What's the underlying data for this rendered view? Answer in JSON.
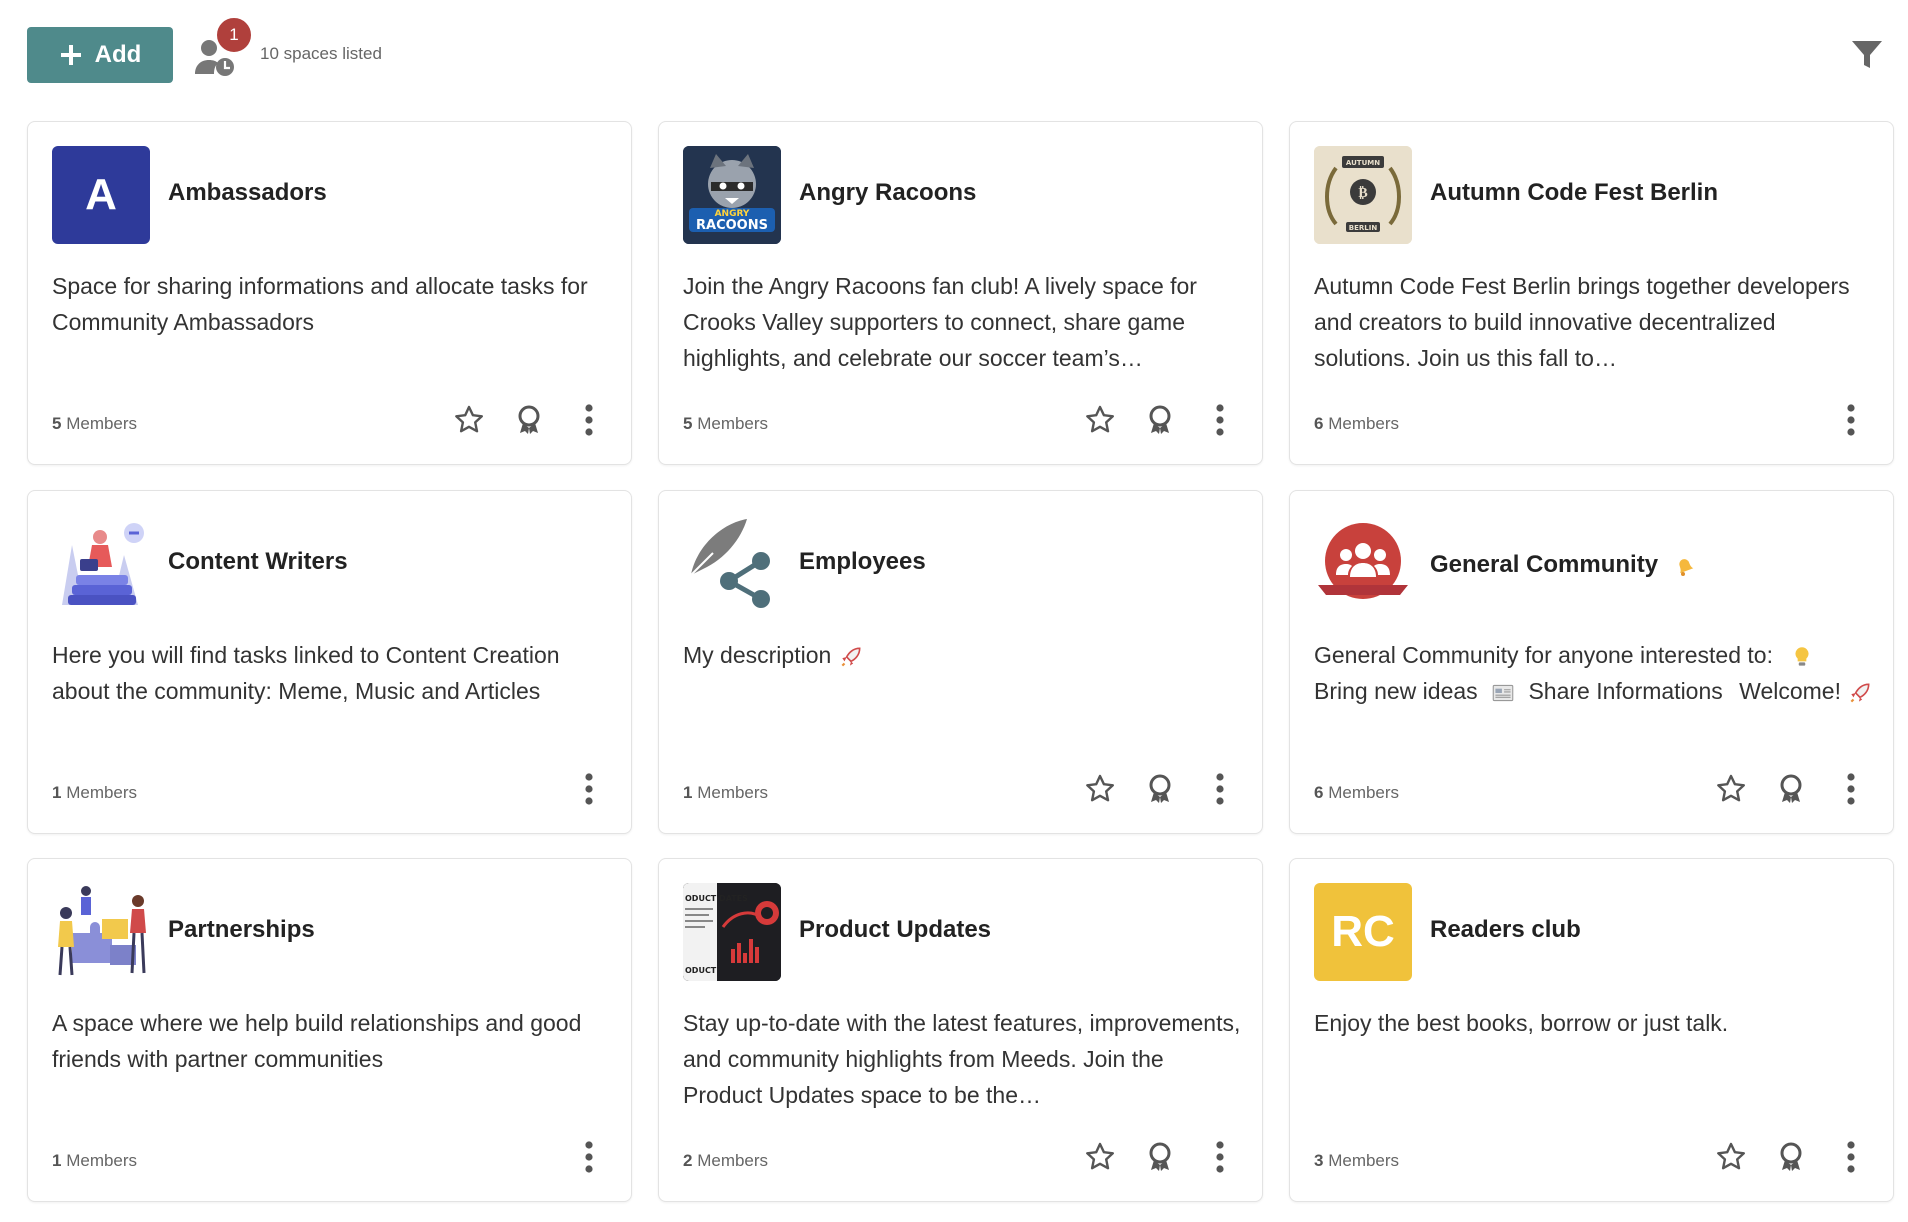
{
  "toolbar": {
    "add_label": "Add",
    "pending_requests_badge": "1",
    "spaces_count": "10 spaces listed"
  },
  "colors": {
    "primary": "#4f8a8b",
    "badge": "#b0403c",
    "ambassadors_avatar": "#2e3a9a",
    "readers_avatar": "#f0c23b",
    "general_avatar": "#c8413c"
  },
  "spaces": [
    {
      "title": "Ambassadors",
      "avatar_text": "A",
      "description": "Space for sharing informations and allocate tasks for Community Ambassadors",
      "members_count": "5",
      "members_label": "Members"
    },
    {
      "title": "Angry Racoons",
      "avatar_text": "ANGRY RACOONS",
      "description": "Join the Angry Racoons fan club! A lively space for Crooks Valley supporters to connect, share game highlights, and celebrate our soccer team’s…",
      "members_count": "5",
      "members_label": "Members"
    },
    {
      "title": "Autumn Code Fest Berlin",
      "avatar_text": "AUTUMN CODE FEST BERLIN",
      "description": "Autumn Code Fest Berlin brings together developers and creators to build innovative decentralized solutions. Join us this fall to…",
      "members_count": "6",
      "members_label": "Members"
    },
    {
      "title": "Content Writers",
      "description": "Here you will find tasks linked to Content Creation about the community: Meme, Music and Articles",
      "members_count": "1",
      "members_label": "Members"
    },
    {
      "title": "Employees",
      "description": "My description",
      "members_count": "1",
      "members_label": "Members"
    },
    {
      "title": "General Community",
      "description_a": "General Community for anyone interested to:",
      "description_b": "Bring new ideas",
      "description_c": "Share Informations",
      "description_d": "Welcome!",
      "members_count": "6",
      "members_label": "Members"
    },
    {
      "title": "Partnerships",
      "description": "A space where we help build relationships and good friends with partner communities",
      "members_count": "1",
      "members_label": "Members"
    },
    {
      "title": "Product Updates",
      "avatar_text_top": "ODUCT DATES",
      "avatar_text_bottom": "ODUCT DATES",
      "description": "Stay up-to-date with the latest features, improvements, and community highlights from Meeds. Join the Product Updates space to be the…",
      "members_count": "2",
      "members_label": "Members"
    },
    {
      "title": "Readers club",
      "avatar_text": "RC",
      "description": "Enjoy the best books, borrow or just talk.",
      "members_count": "3",
      "members_label": "Members"
    }
  ],
  "icons": {
    "add": "plus-icon",
    "requests": "user-clock-icon",
    "filter": "filter-icon",
    "favorite": "star-outline-icon",
    "host": "award-icon",
    "menu": "dots-vertical-icon"
  }
}
